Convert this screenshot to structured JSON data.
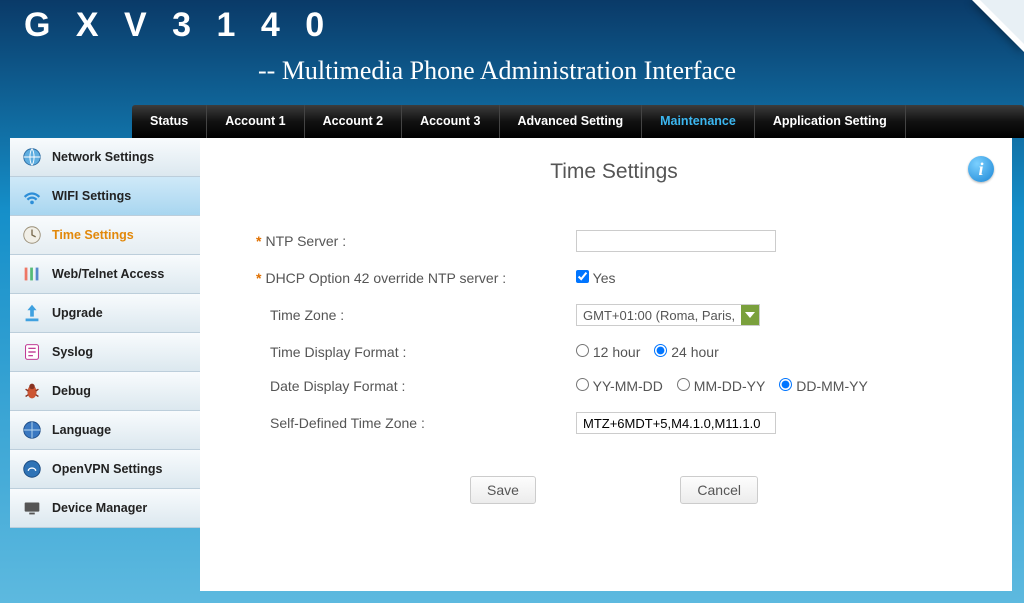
{
  "brand": "G X V 3 1 4 0",
  "subtitle": "-- Multimedia Phone Administration Interface",
  "topnav": [
    {
      "label": "Status",
      "active": false
    },
    {
      "label": "Account 1",
      "active": false
    },
    {
      "label": "Account 2",
      "active": false
    },
    {
      "label": "Account 3",
      "active": false
    },
    {
      "label": "Advanced Setting",
      "active": false
    },
    {
      "label": "Maintenance",
      "active": true
    },
    {
      "label": "Application Setting",
      "active": false
    }
  ],
  "sidebar": [
    {
      "label": "Network Settings",
      "state": "",
      "icon": "globe-icon"
    },
    {
      "label": "WIFI Settings",
      "state": "hover",
      "icon": "wifi-icon"
    },
    {
      "label": "Time Settings",
      "state": "selected",
      "icon": "clock-icon"
    },
    {
      "label": "Web/Telnet Access",
      "state": "",
      "icon": "sliders-icon"
    },
    {
      "label": "Upgrade",
      "state": "",
      "icon": "upload-icon"
    },
    {
      "label": "Syslog",
      "state": "",
      "icon": "log-icon"
    },
    {
      "label": "Debug",
      "state": "",
      "icon": "bug-icon"
    },
    {
      "label": "Language",
      "state": "",
      "icon": "language-icon"
    },
    {
      "label": "OpenVPN Settings",
      "state": "",
      "icon": "vpn-icon"
    },
    {
      "label": "Device Manager",
      "state": "",
      "icon": "device-icon"
    }
  ],
  "page": {
    "title": "Time Settings",
    "ntp_server_label": "NTP Server :",
    "ntp_server_value": "",
    "dhcp42_label": "DHCP Option 42 override NTP server :",
    "dhcp42_yes": "Yes",
    "dhcp42_checked": true,
    "timezone_label": "Time Zone :",
    "timezone_value": "GMT+01:00 (Roma, Paris,",
    "timeformat_label": "Time Display Format :",
    "timeformat_opts": [
      "12 hour",
      "24 hour"
    ],
    "timeformat_selected": "24 hour",
    "dateformat_label": "Date Display Format :",
    "dateformat_opts": [
      "YY-MM-DD",
      "MM-DD-YY",
      "DD-MM-YY"
    ],
    "dateformat_selected": "DD-MM-YY",
    "selftz_label": "Self-Defined Time Zone :",
    "selftz_value": "MTZ+6MDT+5,M4.1.0,M11.1.0",
    "save": "Save",
    "cancel": "Cancel"
  }
}
